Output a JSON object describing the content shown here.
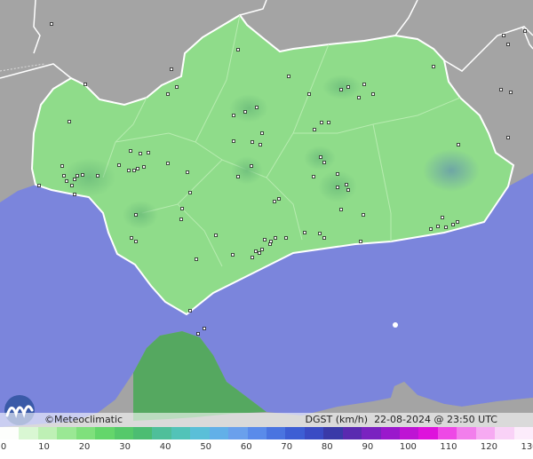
{
  "map": {
    "sea_color": "#7b85dc",
    "land_color": "#8fdc8a",
    "neighbor_land_color": "#a4a4a4",
    "africa_land_color": "#55a860",
    "stations_shown": true
  },
  "brand": {
    "name": "Meteoclimatic",
    "symbol": "©"
  },
  "parameter": {
    "label": "DGST (km/h)",
    "datetime": "22-08-2024 @ 23:50 UTC"
  },
  "scale": {
    "ticks": [
      "0",
      "10",
      "20",
      "30",
      "40",
      "50",
      "60",
      "70",
      "80",
      "90",
      "100",
      "110",
      "120",
      "130"
    ],
    "colors": [
      "#fdfefc",
      "#d9f7d3",
      "#bef0b5",
      "#9ae894",
      "#7fe07c",
      "#64d66b",
      "#55c96a",
      "#4cbd72",
      "#4fbf9a",
      "#52c3b8",
      "#5abfd8",
      "#62b0e8",
      "#6aa0ec",
      "#5a8bea",
      "#4a74e0",
      "#3d5ed4",
      "#3a4bc4",
      "#3a3aa8",
      "#5a2ab0",
      "#7a22c0",
      "#9a18cc",
      "#be14d4",
      "#de12dc",
      "#ee48e6",
      "#f27eec",
      "#f6aaf2",
      "#f9d2f7",
      "#fcecfb"
    ]
  }
}
